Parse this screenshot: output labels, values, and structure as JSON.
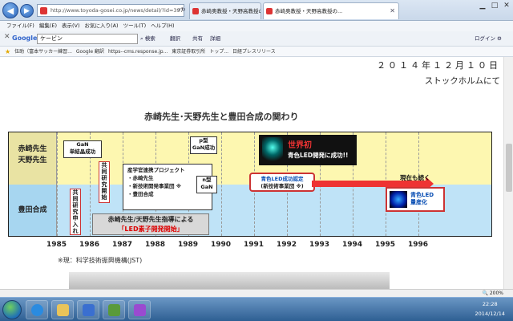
{
  "browser": {
    "address": "http://www.toyoda-gosei.co.jp/news/detail/?id=397",
    "tabs": [
      {
        "label": "赤崎奥教授・天野高教授の..."
      },
      {
        "label": "赤崎奥教授・天野高教授の..."
      }
    ],
    "menu": [
      "ファイル(F)",
      "編集(E)",
      "表示(V)",
      "お気に入り(A)",
      "ツール(T)",
      "ヘルプ(H)"
    ],
    "toolbar": {
      "google": "Google",
      "search_value": "ケービン",
      "search_label": "検索",
      "translate_label": "翻訳",
      "share_label": "共有",
      "details_label": "詳細",
      "login_label": "ログイン",
      "settings_label": "設定"
    },
    "favorites": [
      "伍助（富本サッカー練習...",
      "Google 翻訳",
      "https--cms.response.jp...",
      "東京証券取引所",
      "トップ...",
      "日経プレスリリース"
    ],
    "zoom": "200%"
  },
  "page": {
    "date": "２０１４年１２月１０日",
    "place": "ストックホルムにて",
    "slide_title": "赤崎先生･天野先生と豊田合成の関わり",
    "chart": {
      "row_top": [
        "赤崎先生",
        "天野先生"
      ],
      "row_bottom": "豊田合成",
      "gan_single": [
        "GaN",
        "単結晶成功"
      ],
      "joint_research": "共同研究開始",
      "joint_apply": "共同研究申入れ",
      "project_title": "産学官連携プロジェクト",
      "project_items": [
        "・赤崎先生",
        "・新技術開発事業団 ※",
        "・豊田合成"
      ],
      "ptype": [
        "p型",
        "GaN成功"
      ],
      "ntype": [
        "n型",
        "GaN"
      ],
      "guide": [
        "赤崎先生/天野先生指導による",
        "「LED素子開発開始」"
      ],
      "world_first": "世界初",
      "world_sub": "青色LED開発に成功!!",
      "cert": [
        "青色LED成功認定",
        "(新技術事業団 ※)"
      ],
      "now": "現在も続く",
      "mass": [
        "青色LED",
        "量産化"
      ],
      "years": [
        "1985",
        "1986",
        "1987",
        "1988",
        "1989",
        "1990",
        "1991",
        "1992",
        "1993",
        "1994",
        "1995",
        "1996"
      ]
    },
    "note": "※現：科学技術振興機構(JST)"
  },
  "taskbar": {
    "time": "22:28",
    "date": "2014/12/14"
  },
  "colors": {
    "top_band": "#fdf7b0",
    "bottom_band": "#bfe3f7",
    "accent_red": "#dd3333",
    "accent_blue": "#0a4fb4"
  }
}
